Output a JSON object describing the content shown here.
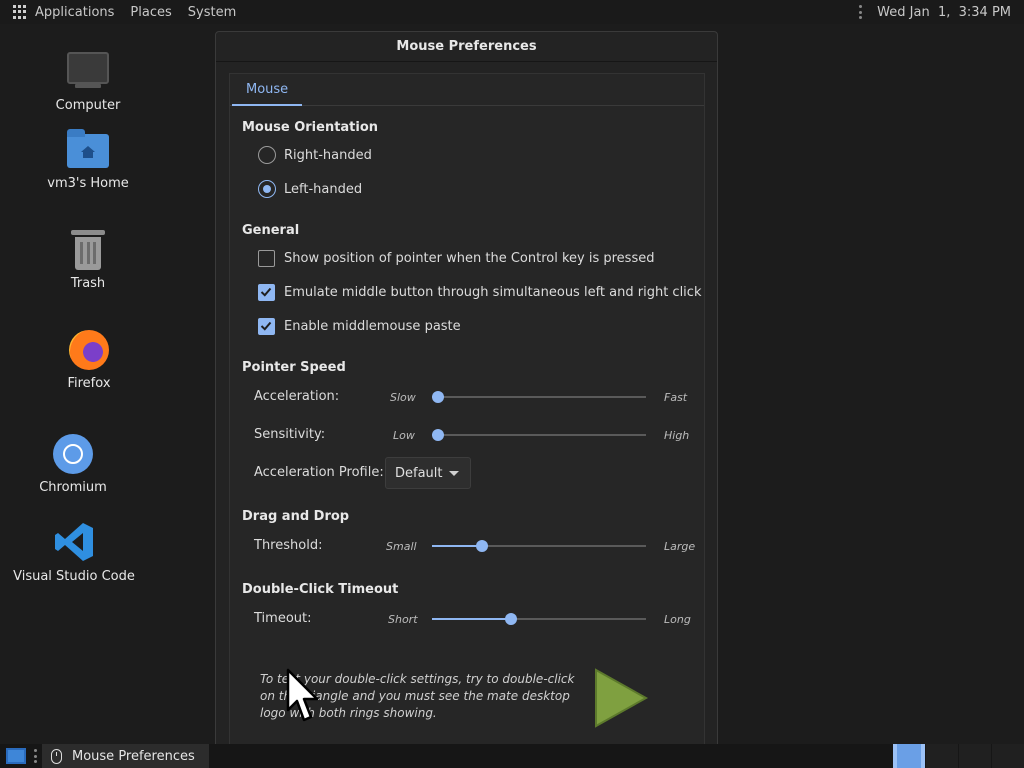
{
  "top_panel": {
    "menus": [
      "Applications",
      "Places",
      "System"
    ],
    "clock": "Wed Jan  1,  3:34 PM"
  },
  "desktop": {
    "icons": [
      {
        "label": "Computer",
        "icon": "computer-icon"
      },
      {
        "label": "vm3's Home",
        "icon": "home-folder-icon"
      },
      {
        "label": "Trash",
        "icon": "trash-icon"
      },
      {
        "label": "Firefox",
        "icon": "firefox-icon"
      },
      {
        "label": "Chromium",
        "icon": "chromium-icon"
      },
      {
        "label": "Visual Studio Code",
        "icon": "vscode-icon"
      }
    ]
  },
  "dialog": {
    "title": "Mouse Preferences",
    "tab": "Mouse",
    "orientation": {
      "title": "Mouse Orientation",
      "right_handed": "Right-handed",
      "left_handed": "Left-handed",
      "selected": "left_handed"
    },
    "general": {
      "title": "General",
      "show_pointer": {
        "label": "Show position of pointer when the Control key is pressed",
        "checked": false
      },
      "emulate_middle": {
        "label": "Emulate middle button through simultaneous left and right click",
        "checked": true
      },
      "middle_paste": {
        "label": "Enable middlemouse paste",
        "checked": true
      }
    },
    "pointer_speed": {
      "title": "Pointer Speed",
      "acceleration": {
        "label": "Acceleration:",
        "min": "Slow",
        "max": "Fast",
        "value": 0.0
      },
      "sensitivity": {
        "label": "Sensitivity:",
        "min": "Low",
        "max": "High",
        "value": 0.0
      },
      "profile": {
        "label": "Acceleration Profile:",
        "value": "Default"
      }
    },
    "drag_drop": {
      "title": "Drag and Drop",
      "threshold": {
        "label": "Threshold:",
        "min": "Small",
        "max": "Large",
        "value": 0.22
      }
    },
    "double_click": {
      "title": "Double-Click Timeout",
      "timeout": {
        "label": "Timeout:",
        "min": "Short",
        "max": "Long",
        "value": 0.36
      },
      "hint": "To test your double-click settings, try to double-click on the triangle and you must see the mate desktop logo with both rings showing."
    }
  },
  "taskbar": {
    "task_label": "Mouse Preferences"
  },
  "colors": {
    "accent": "#8fb7f2",
    "triangle": "#7fa040"
  }
}
